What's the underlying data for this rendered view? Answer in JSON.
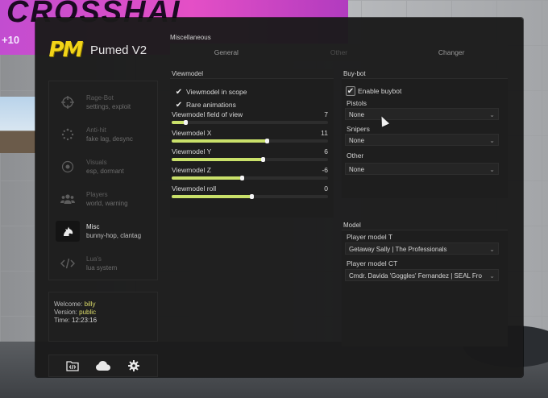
{
  "background": {
    "banner_text": "CROSSHAI",
    "banner_sub": "+10"
  },
  "brand": {
    "logo_text": "PM",
    "name": "Pumed V2"
  },
  "nav": [
    {
      "title": "Rage-Bot",
      "subtitle": "settings, exploit",
      "icon": "crosshair-icon",
      "active": false
    },
    {
      "title": "Anti-hit",
      "subtitle": "fake lag, desync",
      "icon": "spinner-icon",
      "active": false
    },
    {
      "title": "Visuals",
      "subtitle": "esp, dormant",
      "icon": "eye-icon",
      "active": false
    },
    {
      "title": "Players",
      "subtitle": "world, warning",
      "icon": "users-icon",
      "active": false
    },
    {
      "title": "Misc",
      "subtitle": "bunny-hop, clantag",
      "icon": "horse-icon",
      "active": true
    },
    {
      "title": "Lua's",
      "subtitle": "lua system",
      "icon": "code-icon",
      "active": false
    }
  ],
  "info": {
    "welcome_label": "Welcome:",
    "welcome_value": "billy",
    "version_label": "Version:",
    "version_value": "public",
    "time_label": "Time:",
    "time_value": "12:23:16"
  },
  "tools": [
    "folder-code-icon",
    "cloud-icon",
    "gear-icon"
  ],
  "misc": {
    "title": "Miscellaneous",
    "tabs": [
      {
        "label": "General",
        "active": true
      },
      {
        "label": "Other",
        "active": false
      },
      {
        "label": "Changer",
        "active": true
      }
    ]
  },
  "viewmodel": {
    "title": "Viewmodel",
    "checks": [
      {
        "label": "Viewmodel in scope",
        "checked": true
      },
      {
        "label": "Rare animations",
        "checked": true
      }
    ],
    "sliders": [
      {
        "label": "Viewmodel field of view",
        "value": "7",
        "fill": 0.09
      },
      {
        "label": "Viewmodel X",
        "value": "11",
        "fill": 0.61
      },
      {
        "label": "Viewmodel Y",
        "value": "6",
        "fill": 0.58
      },
      {
        "label": "Viewmodel Z",
        "value": "-6",
        "fill": 0.45
      },
      {
        "label": "Viewmodel roll",
        "value": "0",
        "fill": 0.51
      }
    ]
  },
  "buybot": {
    "title": "Buy-bot",
    "enable_label": "Enable buybot",
    "enabled": true,
    "pistols_label": "Pistols",
    "pistols_value": "None",
    "snipers_label": "Snipers",
    "snipers_value": "None",
    "other_label": "Other",
    "other_value": "None"
  },
  "model": {
    "title": "Model",
    "t_label": "Player model T",
    "t_value": "Getaway Sally | The Professionals",
    "ct_label": "Player model CT",
    "ct_value": "Cmdr. Davida 'Goggles' Fernandez | SEAL Fro"
  },
  "colors": {
    "accent": "#c9e06a",
    "logo": "#f2d418",
    "panel_bg": "#1a1a1a"
  }
}
